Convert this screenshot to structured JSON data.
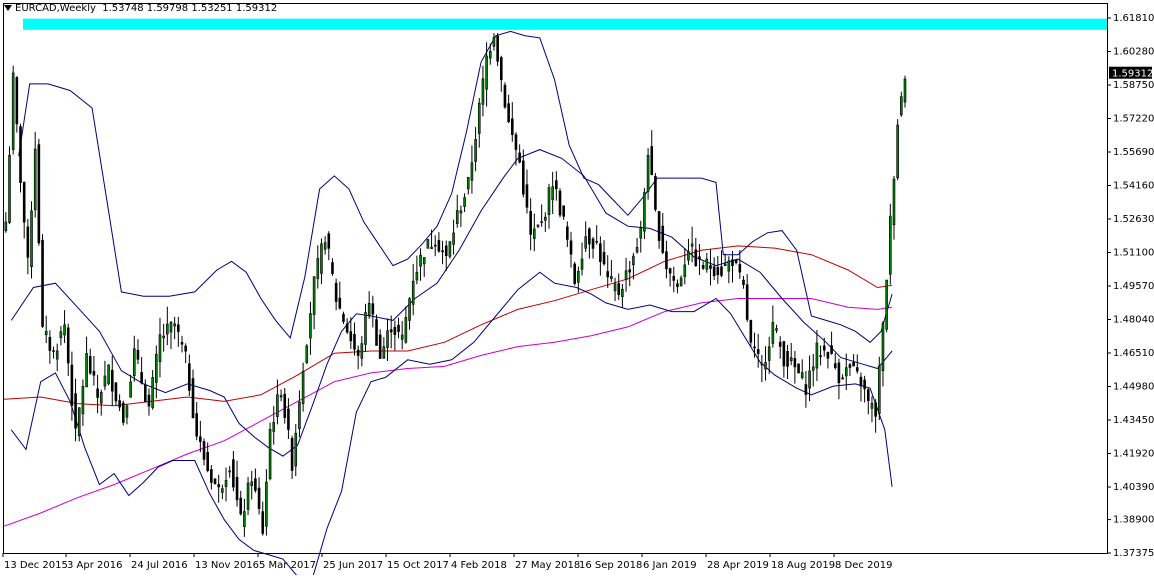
{
  "header": {
    "symbol": "EURCAD,Weekly",
    "ohlc": "1.53748 1.59798 1.53251 1.59312"
  },
  "chart_data": {
    "type": "candlestick",
    "symbol": "EURCAD",
    "timeframe": "Weekly",
    "current_price": "1.59312",
    "y_ticks": [
      "1.61810",
      "1.60280",
      "1.58750",
      "1.57220",
      "1.55690",
      "1.54160",
      "1.52630",
      "1.51100",
      "1.49570",
      "1.48040",
      "1.46510",
      "1.44980",
      "1.43450",
      "1.41920",
      "1.40390",
      "1.38900",
      "1.37375"
    ],
    "x_ticks": [
      "13 Dec 2015",
      "3 Apr 2016",
      "24 Jul 2016",
      "13 Nov 2016",
      "5 Mar 2017",
      "25 Jun 2017",
      "15 Oct 2017",
      "4 Feb 2018",
      "27 May 2018",
      "16 Sep 2018",
      "6 Jan 2019",
      "28 Apr 2019",
      "18 Aug 2019",
      "8 Dec 2019"
    ],
    "ylim": [
      1.37375,
      1.6245
    ],
    "resistance_zone": [
      1.6127,
      1.6178
    ],
    "colors": {
      "bull": "#008000",
      "bear": "#000000",
      "bollinger": "#00007f",
      "ma_mid": "#c00000",
      "ma_long": "#cc00cc",
      "zone": "#00ffff",
      "label_bg": "#000000"
    },
    "price_path": [
      [
        0,
        1.525
      ],
      [
        2,
        1.59
      ],
      [
        4,
        1.545
      ],
      [
        6,
        1.505
      ],
      [
        8,
        1.56
      ],
      [
        10,
        1.475
      ],
      [
        13,
        1.465
      ],
      [
        16,
        1.478
      ],
      [
        19,
        1.427
      ],
      [
        22,
        1.463
      ],
      [
        25,
        1.445
      ],
      [
        28,
        1.457
      ],
      [
        32,
        1.435
      ],
      [
        35,
        1.465
      ],
      [
        39,
        1.44
      ],
      [
        42,
        1.472
      ],
      [
        46,
        1.478
      ],
      [
        49,
        1.462
      ],
      [
        52,
        1.428
      ],
      [
        55,
        1.412
      ],
      [
        58,
        1.402
      ],
      [
        61,
        1.415
      ],
      [
        64,
        1.388
      ],
      [
        67,
        1.409
      ],
      [
        70,
        1.384
      ],
      [
        72,
        1.43
      ],
      [
        75,
        1.449
      ],
      [
        78,
        1.415
      ],
      [
        81,
        1.46
      ],
      [
        84,
        1.497
      ],
      [
        87,
        1.519
      ],
      [
        90,
        1.49
      ],
      [
        93,
        1.476
      ],
      [
        96,
        1.462
      ],
      [
        99,
        1.49
      ],
      [
        102,
        1.463
      ],
      [
        105,
        1.478
      ],
      [
        108,
        1.471
      ],
      [
        111,
        1.5
      ],
      [
        114,
        1.512
      ],
      [
        117,
        1.518
      ],
      [
        120,
        1.508
      ],
      [
        123,
        1.528
      ],
      [
        126,
        1.542
      ],
      [
        128,
        1.565
      ],
      [
        131,
        1.6
      ],
      [
        133,
        1.612
      ],
      [
        135,
        1.59
      ],
      [
        137,
        1.57
      ],
      [
        140,
        1.552
      ],
      [
        143,
        1.518
      ],
      [
        146,
        1.524
      ],
      [
        149,
        1.544
      ],
      [
        152,
        1.525
      ],
      [
        155,
        1.498
      ],
      [
        158,
        1.519
      ],
      [
        161,
        1.515
      ],
      [
        164,
        1.498
      ],
      [
        167,
        1.493
      ],
      [
        170,
        1.505
      ],
      [
        173,
        1.52
      ],
      [
        175,
        1.558
      ],
      [
        177,
        1.528
      ],
      [
        180,
        1.505
      ],
      [
        183,
        1.495
      ],
      [
        186,
        1.514
      ],
      [
        189,
        1.505
      ],
      [
        192,
        1.505
      ],
      [
        195,
        1.503
      ],
      [
        198,
        1.508
      ],
      [
        201,
        1.494
      ],
      [
        203,
        1.468
      ],
      [
        206,
        1.458
      ],
      [
        209,
        1.478
      ],
      [
        212,
        1.463
      ],
      [
        215,
        1.458
      ],
      [
        218,
        1.45
      ],
      [
        221,
        1.466
      ],
      [
        224,
        1.466
      ],
      [
        227,
        1.455
      ],
      [
        230,
        1.458
      ],
      [
        233,
        1.452
      ],
      [
        235,
        1.442
      ],
      [
        237,
        1.438
      ],
      [
        239,
        1.476
      ],
      [
        241,
        1.525
      ],
      [
        243,
        1.571
      ],
      [
        245,
        1.593
      ]
    ],
    "overlays": {
      "ma_mid": [
        [
          0,
          1.444
        ],
        [
          10,
          1.445
        ],
        [
          20,
          1.442
        ],
        [
          30,
          1.441
        ],
        [
          40,
          1.443
        ],
        [
          50,
          1.445
        ],
        [
          60,
          1.443
        ],
        [
          70,
          1.446
        ],
        [
          80,
          1.455
        ],
        [
          90,
          1.465
        ],
        [
          100,
          1.466
        ],
        [
          110,
          1.466
        ],
        [
          120,
          1.47
        ],
        [
          130,
          1.478
        ],
        [
          140,
          1.485
        ],
        [
          150,
          1.489
        ],
        [
          160,
          1.494
        ],
        [
          170,
          1.499
        ],
        [
          180,
          1.507
        ],
        [
          190,
          1.512
        ],
        [
          200,
          1.514
        ],
        [
          210,
          1.513
        ],
        [
          220,
          1.51
        ],
        [
          230,
          1.503
        ],
        [
          238,
          1.495
        ],
        [
          242,
          1.496
        ]
      ],
      "ma_long": [
        [
          0,
          1.386
        ],
        [
          10,
          1.392
        ],
        [
          20,
          1.399
        ],
        [
          30,
          1.405
        ],
        [
          40,
          1.412
        ],
        [
          50,
          1.419
        ],
        [
          60,
          1.425
        ],
        [
          70,
          1.434
        ],
        [
          80,
          1.443
        ],
        [
          90,
          1.452
        ],
        [
          100,
          1.456
        ],
        [
          110,
          1.458
        ],
        [
          120,
          1.459
        ],
        [
          130,
          1.464
        ],
        [
          140,
          1.468
        ],
        [
          150,
          1.47
        ],
        [
          160,
          1.473
        ],
        [
          170,
          1.477
        ],
        [
          180,
          1.484
        ],
        [
          190,
          1.488
        ],
        [
          200,
          1.49
        ],
        [
          210,
          1.49
        ],
        [
          220,
          1.49
        ],
        [
          230,
          1.486
        ],
        [
          238,
          1.485
        ],
        [
          242,
          1.486
        ]
      ],
      "bb_upper": [
        [
          4,
          1.555
        ],
        [
          7,
          1.588
        ],
        [
          12,
          1.588
        ],
        [
          18,
          1.585
        ],
        [
          24,
          1.577
        ],
        [
          28,
          1.535
        ],
        [
          32,
          1.493
        ],
        [
          38,
          1.491
        ],
        [
          45,
          1.491
        ],
        [
          52,
          1.493
        ],
        [
          58,
          1.503
        ],
        [
          62,
          1.507
        ],
        [
          66,
          1.502
        ],
        [
          70,
          1.49
        ],
        [
          74,
          1.48
        ],
        [
          78,
          1.472
        ],
        [
          82,
          1.5
        ],
        [
          86,
          1.54
        ],
        [
          90,
          1.546
        ],
        [
          94,
          1.54
        ],
        [
          98,
          1.525
        ],
        [
          102,
          1.515
        ],
        [
          106,
          1.505
        ],
        [
          110,
          1.508
        ],
        [
          114,
          1.515
        ],
        [
          118,
          1.523
        ],
        [
          122,
          1.538
        ],
        [
          126,
          1.566
        ],
        [
          130,
          1.598
        ],
        [
          134,
          1.61
        ],
        [
          138,
          1.612
        ],
        [
          142,
          1.61
        ],
        [
          146,
          1.609
        ],
        [
          150,
          1.59
        ],
        [
          154,
          1.56
        ],
        [
          158,
          1.545
        ],
        [
          162,
          1.542
        ],
        [
          166,
          1.535
        ],
        [
          170,
          1.528
        ],
        [
          174,
          1.536
        ],
        [
          178,
          1.545
        ],
        [
          182,
          1.545
        ],
        [
          186,
          1.545
        ],
        [
          190,
          1.545
        ],
        [
          194,
          1.543
        ],
        [
          196,
          1.51
        ],
        [
          200,
          1.51
        ],
        [
          204,
          1.516
        ],
        [
          208,
          1.52
        ],
        [
          212,
          1.521
        ],
        [
          216,
          1.512
        ],
        [
          220,
          1.482
        ],
        [
          224,
          1.48
        ],
        [
          228,
          1.478
        ],
        [
          232,
          1.475
        ],
        [
          236,
          1.47
        ],
        [
          239,
          1.475
        ],
        [
          242,
          1.492
        ]
      ],
      "bb_mid": [
        [
          2,
          1.48
        ],
        [
          8,
          1.495
        ],
        [
          14,
          1.497
        ],
        [
          20,
          1.486
        ],
        [
          26,
          1.475
        ],
        [
          32,
          1.457
        ],
        [
          38,
          1.451
        ],
        [
          44,
          1.447
        ],
        [
          50,
          1.451
        ],
        [
          56,
          1.448
        ],
        [
          60,
          1.445
        ],
        [
          64,
          1.433
        ],
        [
          68,
          1.427
        ],
        [
          72,
          1.422
        ],
        [
          76,
          1.418
        ],
        [
          80,
          1.423
        ],
        [
          84,
          1.441
        ],
        [
          88,
          1.46
        ],
        [
          92,
          1.475
        ],
        [
          96,
          1.483
        ],
        [
          100,
          1.482
        ],
        [
          106,
          1.48
        ],
        [
          112,
          1.49
        ],
        [
          118,
          1.497
        ],
        [
          124,
          1.512
        ],
        [
          130,
          1.53
        ],
        [
          136,
          1.545
        ],
        [
          140,
          1.554
        ],
        [
          146,
          1.558
        ],
        [
          152,
          1.554
        ],
        [
          158,
          1.546
        ],
        [
          164,
          1.529
        ],
        [
          170,
          1.523
        ],
        [
          176,
          1.522
        ],
        [
          182,
          1.518
        ],
        [
          188,
          1.509
        ],
        [
          194,
          1.505
        ],
        [
          200,
          1.508
        ],
        [
          206,
          1.502
        ],
        [
          212,
          1.49
        ],
        [
          218,
          1.479
        ],
        [
          224,
          1.47
        ],
        [
          228,
          1.463
        ],
        [
          234,
          1.46
        ],
        [
          238,
          1.458
        ],
        [
          242,
          1.466
        ]
      ],
      "bb_lower": [
        [
          2,
          1.43
        ],
        [
          6,
          1.421
        ],
        [
          10,
          1.452
        ],
        [
          14,
          1.456
        ],
        [
          18,
          1.443
        ],
        [
          22,
          1.422
        ],
        [
          26,
          1.405
        ],
        [
          30,
          1.41
        ],
        [
          34,
          1.4
        ],
        [
          38,
          1.406
        ],
        [
          42,
          1.413
        ],
        [
          46,
          1.416
        ],
        [
          52,
          1.416
        ],
        [
          56,
          1.401
        ],
        [
          60,
          1.389
        ],
        [
          64,
          1.38
        ],
        [
          68,
          1.375
        ],
        [
          72,
          1.373
        ],
        [
          76,
          1.371
        ],
        [
          80,
          1.363
        ],
        [
          84,
          1.362
        ],
        [
          88,
          1.385
        ],
        [
          92,
          1.402
        ],
        [
          96,
          1.438
        ],
        [
          100,
          1.452
        ],
        [
          104,
          1.454
        ],
        [
          110,
          1.462
        ],
        [
          116,
          1.46
        ],
        [
          122,
          1.462
        ],
        [
          128,
          1.47
        ],
        [
          134,
          1.482
        ],
        [
          140,
          1.494
        ],
        [
          146,
          1.502
        ],
        [
          150,
          1.497
        ],
        [
          156,
          1.495
        ],
        [
          160,
          1.492
        ],
        [
          164,
          1.488
        ],
        [
          170,
          1.485
        ],
        [
          176,
          1.487
        ],
        [
          182,
          1.484
        ],
        [
          188,
          1.484
        ],
        [
          194,
          1.49
        ],
        [
          198,
          1.483
        ],
        [
          202,
          1.472
        ],
        [
          206,
          1.461
        ],
        [
          210,
          1.455
        ],
        [
          216,
          1.449
        ],
        [
          220,
          1.446
        ],
        [
          226,
          1.45
        ],
        [
          232,
          1.451
        ],
        [
          236,
          1.449
        ],
        [
          240,
          1.43
        ],
        [
          242,
          1.404
        ]
      ]
    }
  }
}
